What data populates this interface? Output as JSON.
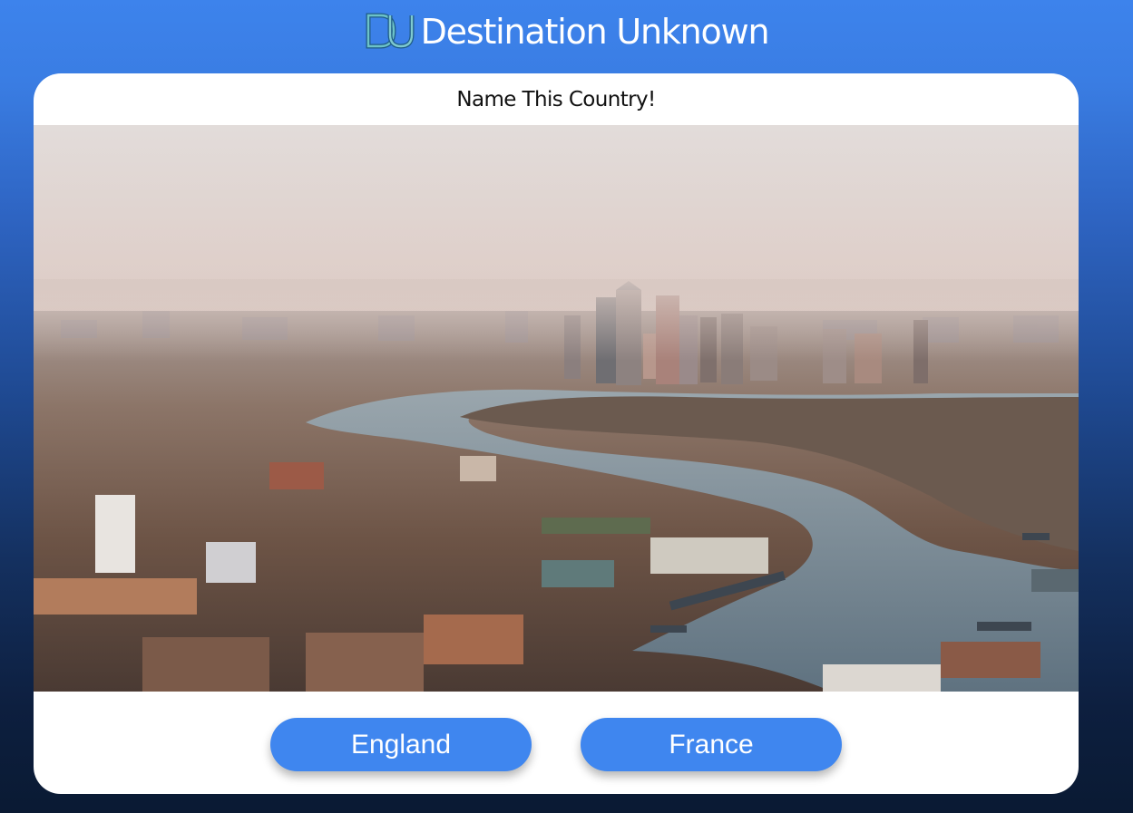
{
  "header": {
    "logo_icon": "du-logo-icon",
    "title": "Destination Unknown"
  },
  "quiz": {
    "prompt": "Name This Country!",
    "image_icon": "london-thames-aerial-photo",
    "answers": [
      {
        "label": "England"
      },
      {
        "label": "France"
      }
    ]
  },
  "colors": {
    "background_top": "#3d83ec",
    "background_bottom": "#0a1a33",
    "button": "#3f86ef",
    "card": "#ffffff"
  }
}
